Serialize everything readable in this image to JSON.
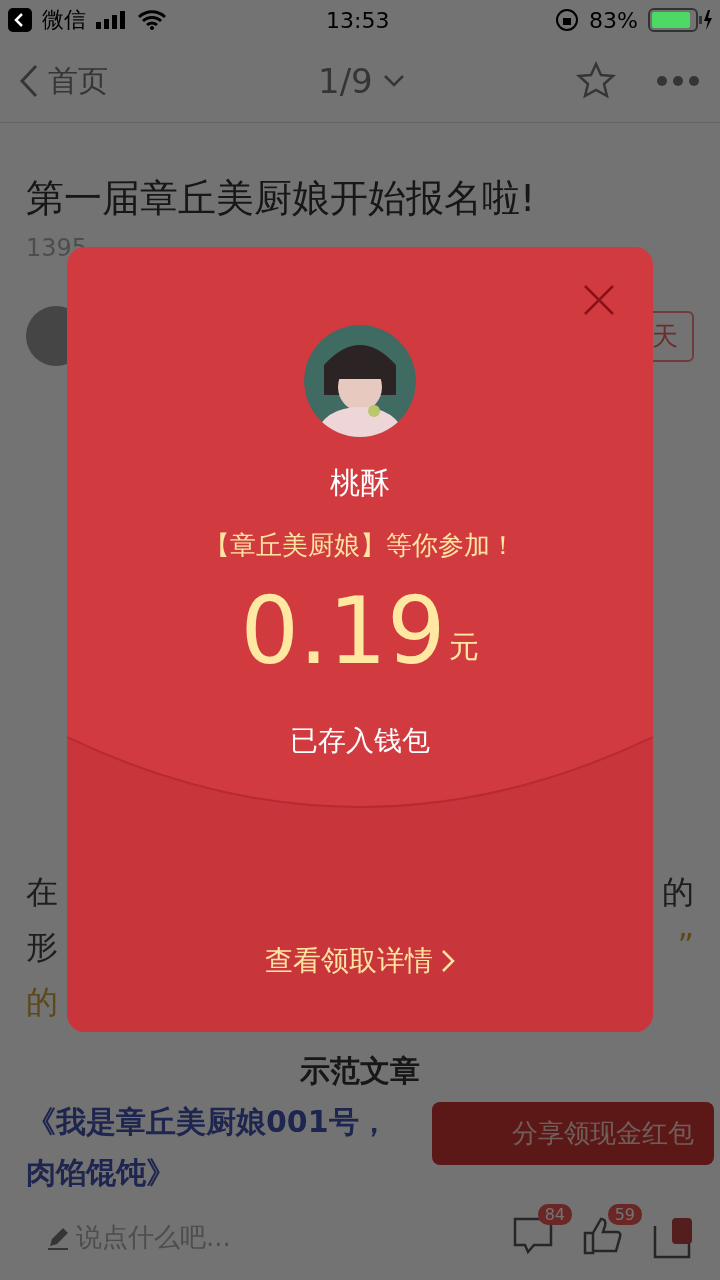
{
  "status_bar": {
    "back_app": "微信",
    "time": "13:53",
    "battery": "83%"
  },
  "nav": {
    "back": "首页",
    "page": "1/9"
  },
  "article": {
    "title": "第一届章丘美厨娘开始报名啦!",
    "meta": "1395",
    "follow": "天",
    "lines": [
      {
        "left": "在",
        "right": "的"
      },
      {
        "left": "形",
        "right": "”"
      },
      {
        "left": "的"
      }
    ],
    "section_title": "示范文章",
    "link_lines": [
      "《我是章丘美厨娘001号，",
      "肉馅馄饨》"
    ]
  },
  "share_bubble": "分享领现金红包",
  "bottom_bar": {
    "placeholder": "说点什么吧...",
    "comments": "84",
    "likes": "59"
  },
  "modal": {
    "name": "桃酥",
    "invite": "【章丘美厨娘】等你参加！",
    "amount": "0.19",
    "unit": "元",
    "status": "已存入钱包",
    "details": "查看领取详情"
  }
}
